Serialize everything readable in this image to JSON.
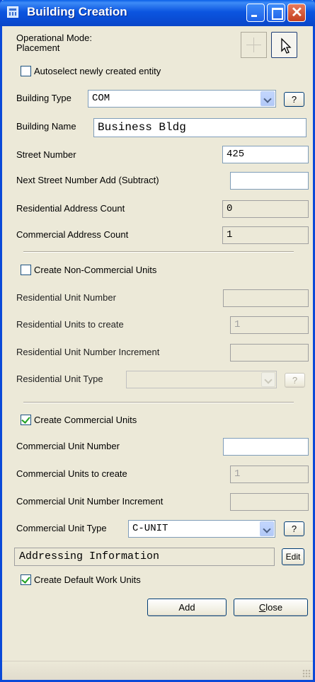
{
  "window": {
    "title": "Building Creation"
  },
  "mode": {
    "label": "Operational Mode:",
    "value": "Placement"
  },
  "autoselect": {
    "label": "Autoselect newly created entity",
    "checked": false
  },
  "building_type": {
    "label": "Building Type",
    "value": "COM",
    "help": "?"
  },
  "building_name": {
    "label": "Building Name",
    "value": "Business Bldg"
  },
  "street_number": {
    "label": "Street Number",
    "value": "425"
  },
  "next_street": {
    "label": "Next Street Number Add (Subtract)",
    "value": ""
  },
  "res_addr_count": {
    "label": "Residential Address Count",
    "value": "0"
  },
  "com_addr_count": {
    "label": "Commercial Address Count",
    "value": "1"
  },
  "non_com_units": {
    "checkbox_label": "Create Non-Commercial Units",
    "checked": false,
    "unit_number_label": "Residential Unit Number",
    "unit_number": "",
    "to_create_label": "Residential Units to create",
    "to_create": "1",
    "increment_label": "Residential Unit Number Increment",
    "increment": "",
    "type_label": "Residential Unit Type",
    "type_value": "",
    "help": "?"
  },
  "com_units": {
    "checkbox_label": "Create Commercial Units",
    "checked": true,
    "unit_number_label": "Commercial Unit Number",
    "unit_number": "",
    "to_create_label": "Commercial Units to create",
    "to_create": "1",
    "increment_label": "Commercial Unit Number Increment",
    "increment": "",
    "type_label": "Commercial Unit Type",
    "type_value": "C-UNIT",
    "help": "?"
  },
  "addressing": {
    "value": "Addressing Information",
    "edit": "Edit"
  },
  "work_units": {
    "label": "Create Default Work Units",
    "checked": true
  },
  "buttons": {
    "add": "Add",
    "close_prefix": "",
    "close_underline": "C",
    "close_rest": "lose"
  }
}
